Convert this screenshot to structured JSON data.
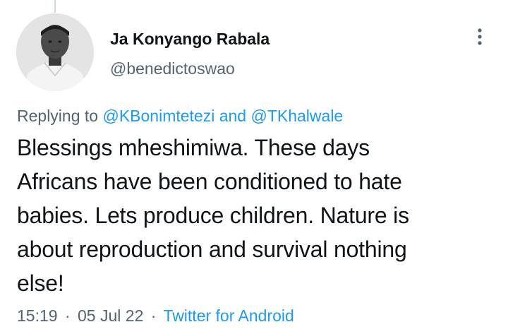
{
  "author": {
    "display_name": "Ja Konyango Rabala",
    "handle": "@benedictoswao"
  },
  "replying": {
    "prefix": "Replying to",
    "mention_1": "@KBonimtetezi",
    "conjunction": "and",
    "mention_2": "@TKhalwale"
  },
  "tweet": {
    "lines": [
      "Blessings mheshimiwa. These days",
      "Africans have been conditioned to hate",
      "babies. Lets produce children. Nature is",
      "about reproduction and survival nothing",
      "else!"
    ]
  },
  "meta": {
    "time": "15:19",
    "separator": "·",
    "date": "05 Jul 22",
    "source": "Twitter for Android"
  },
  "icons": {
    "more": "vertical-ellipsis-icon"
  },
  "colors": {
    "link": "#1d9bf0",
    "secondary_text": "#536471",
    "primary_text": "#0f1419"
  }
}
